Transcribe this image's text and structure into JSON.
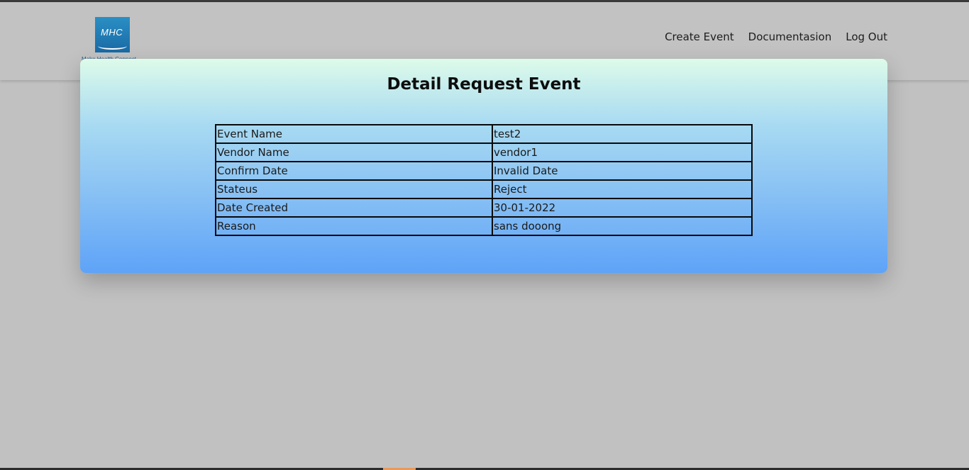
{
  "logo": {
    "text": "MHC",
    "caption": "Make Health Connect"
  },
  "nav": {
    "create_event": "Create Event",
    "documentation": "Documentasion",
    "logout": "Log Out"
  },
  "card": {
    "title": "Detail Request Event"
  },
  "details": [
    {
      "label": "Event Name",
      "value": "test2"
    },
    {
      "label": "Vendor Name",
      "value": "vendor1"
    },
    {
      "label": "Confirm Date",
      "value": "Invalid Date"
    },
    {
      "label": "Stateus",
      "value": "Reject"
    },
    {
      "label": "Date Created",
      "value": "30-01-2022"
    },
    {
      "label": "Reason",
      "value": "sans dooong"
    }
  ],
  "colors": {
    "card_top": "#ddfbe9",
    "card_bottom": "#5ea3f8",
    "overlay": "#c1c1c1"
  }
}
